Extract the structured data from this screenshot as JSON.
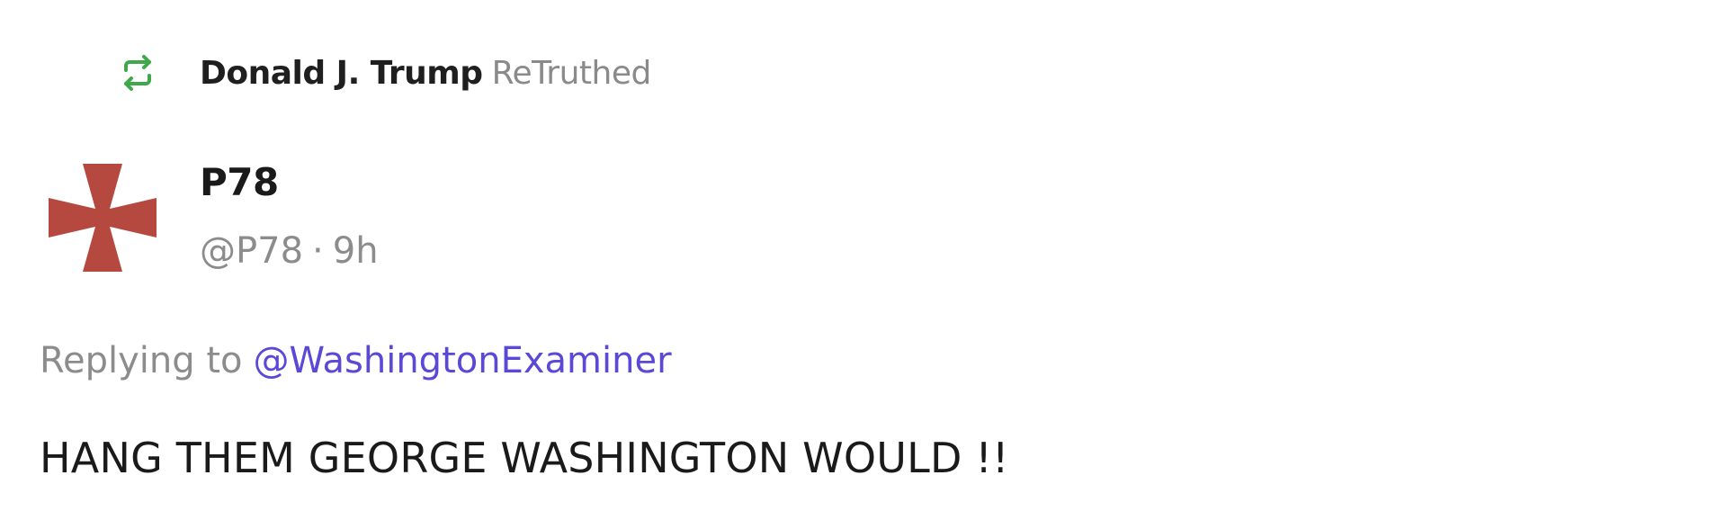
{
  "retruth": {
    "icon": "retruth-icon",
    "icon_color": "#3fa84a",
    "author": "Donald J. Trump",
    "verb": "ReTruthed"
  },
  "post": {
    "avatar": {
      "icon": "cross-pattee-icon",
      "color": "#b5493f"
    },
    "display_name": "P78",
    "handle": "@P78",
    "separator": "·",
    "time": "9h",
    "replying_prefix": "Replying to",
    "replying_to": "@WashingtonExaminer",
    "link_color": "#5a48d6",
    "body": "HANG THEM GEORGE WASHINGTON WOULD !!"
  }
}
